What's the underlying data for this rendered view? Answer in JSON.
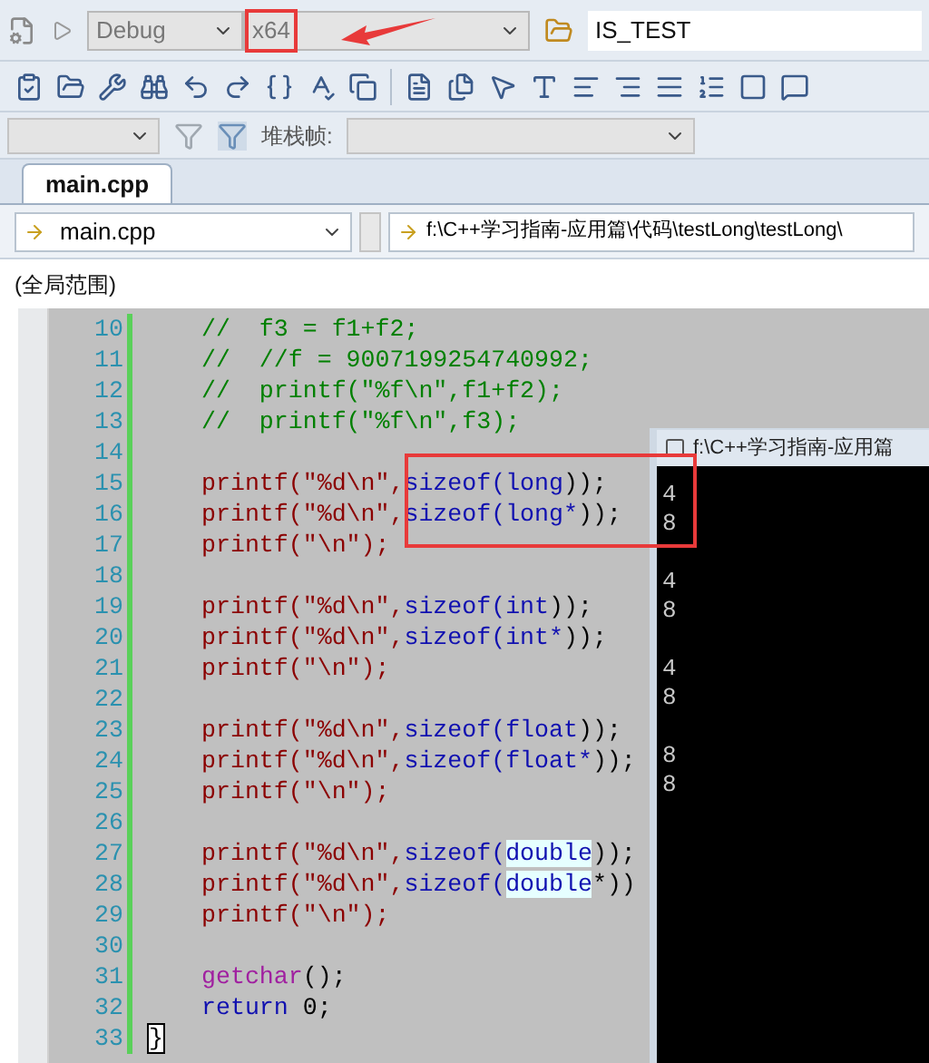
{
  "toolbar": {
    "configuration": "Debug",
    "platform": "x64",
    "platform_marked": true,
    "startup_field": "IS_TEST"
  },
  "debug_toolbar": {
    "stack_frame_label": "堆栈帧:"
  },
  "tabs": [
    {
      "label": "main.cpp",
      "selected": true
    }
  ],
  "navigation": {
    "file": "main.cpp",
    "path": "f:\\C++学习指南-应用篇\\代码\\testLong\\testLong\\"
  },
  "scope": "(全局范围)",
  "editor": {
    "callout_marked": true,
    "lines": [
      {
        "number": "10",
        "tokens": [
          {
            "kind": "comment",
            "text": "//  f3 = f1+f2;"
          }
        ]
      },
      {
        "number": "11",
        "tokens": [
          {
            "kind": "comment",
            "text": "//  //f = 9007199254740992;"
          }
        ]
      },
      {
        "number": "12",
        "tokens": [
          {
            "kind": "comment",
            "text": "//  printf(\"%f\\n\",f1+f2);"
          }
        ]
      },
      {
        "number": "13",
        "tokens": [
          {
            "kind": "comment",
            "text": "//  printf(\"%f\\n\",f3);"
          }
        ]
      },
      {
        "number": "14"
      },
      {
        "number": "15",
        "tokens": [
          {
            "kind": "plain",
            "text": "printf(\"%d\\n\","
          },
          {
            "kind": "keyword",
            "text": "sizeof(long"
          },
          {
            "kind": "punct",
            "text": "));"
          }
        ]
      },
      {
        "number": "16",
        "tokens": [
          {
            "kind": "plain",
            "text": "printf(\"%d\\n\","
          },
          {
            "kind": "keyword",
            "text": "sizeof(long*"
          },
          {
            "kind": "punct",
            "text": "));"
          }
        ]
      },
      {
        "number": "17",
        "tokens": [
          {
            "kind": "plain",
            "text": "printf(\"\\n\");"
          }
        ]
      },
      {
        "number": "18"
      },
      {
        "number": "19",
        "tokens": [
          {
            "kind": "plain",
            "text": "printf(\"%d\\n\","
          },
          {
            "kind": "keyword",
            "text": "sizeof(int"
          },
          {
            "kind": "punct",
            "text": "));"
          }
        ]
      },
      {
        "number": "20",
        "tokens": [
          {
            "kind": "plain",
            "text": "printf(\"%d\\n\","
          },
          {
            "kind": "keyword",
            "text": "sizeof(int*"
          },
          {
            "kind": "punct",
            "text": "));"
          }
        ]
      },
      {
        "number": "21",
        "tokens": [
          {
            "kind": "plain",
            "text": "printf(\"\\n\");"
          }
        ]
      },
      {
        "number": "22"
      },
      {
        "number": "23",
        "tokens": [
          {
            "kind": "plain",
            "text": "printf(\"%d\\n\","
          },
          {
            "kind": "keyword",
            "text": "sizeof(float"
          },
          {
            "kind": "punct",
            "text": "));"
          }
        ]
      },
      {
        "number": "24",
        "tokens": [
          {
            "kind": "plain",
            "text": "printf(\"%d\\n\","
          },
          {
            "kind": "keyword",
            "text": "sizeof(float*"
          },
          {
            "kind": "punct",
            "text": "));"
          }
        ]
      },
      {
        "number": "25",
        "tokens": [
          {
            "kind": "plain",
            "text": "printf(\"\\n\");"
          }
        ]
      },
      {
        "number": "26"
      },
      {
        "number": "27",
        "tokens": [
          {
            "kind": "plain",
            "text": "printf(\"%d\\n\","
          },
          {
            "kind": "keyword",
            "text": "sizeof("
          },
          {
            "kind": "highlight",
            "text": "double"
          },
          {
            "kind": "punct",
            "text": "));"
          }
        ]
      },
      {
        "number": "28",
        "tokens": [
          {
            "kind": "plain",
            "text": "printf(\"%d\\n\","
          },
          {
            "kind": "keyword",
            "text": "sizeof("
          },
          {
            "kind": "highlight",
            "text": "double"
          },
          {
            "kind": "punct",
            "text": "*))"
          }
        ]
      },
      {
        "number": "29",
        "tokens": [
          {
            "kind": "plain",
            "text": "printf(\"\\n\");"
          }
        ]
      },
      {
        "number": "30"
      },
      {
        "number": "31",
        "tokens": [
          {
            "kind": "function",
            "text": "getchar"
          },
          {
            "kind": "punct",
            "text": "();"
          }
        ]
      },
      {
        "number": "32",
        "tokens": [
          {
            "kind": "keyword",
            "text": "return"
          },
          {
            "kind": "punct",
            "text": " 0;"
          }
        ]
      },
      {
        "number": "33",
        "tokens": [
          {
            "kind": "brace",
            "text": "}"
          }
        ]
      }
    ]
  },
  "console": {
    "title": "f:\\C++学习指南-应用篇",
    "groups": [
      [
        "4",
        "8"
      ],
      [
        "4",
        "8"
      ],
      [
        "4",
        "8"
      ],
      [
        "8",
        "8"
      ]
    ]
  }
}
